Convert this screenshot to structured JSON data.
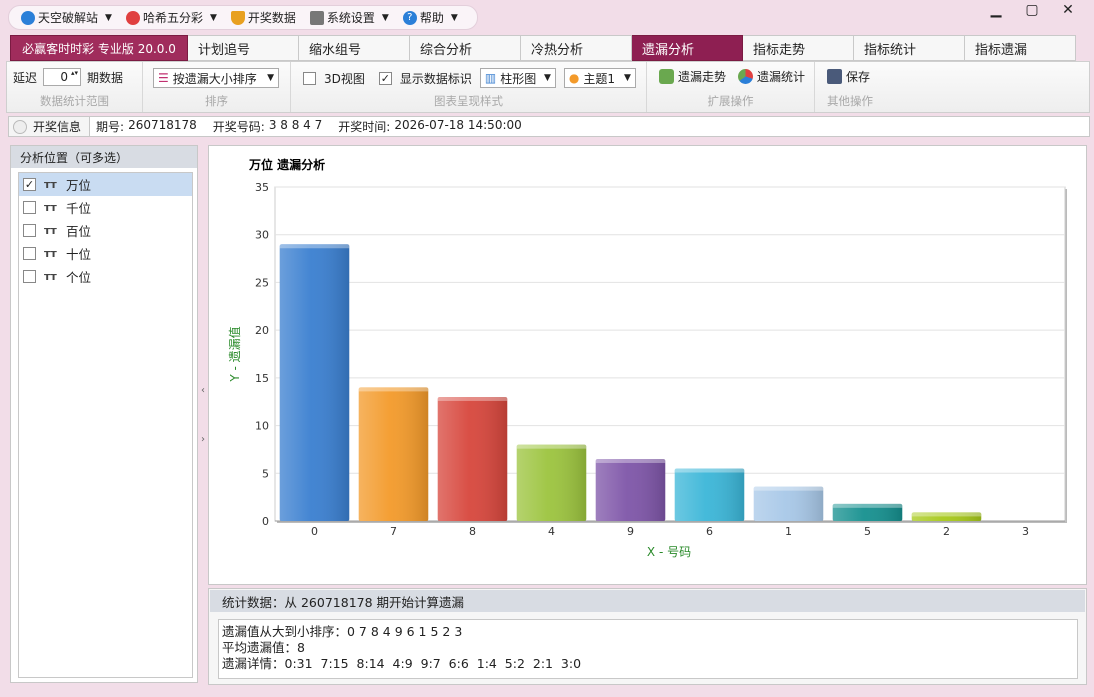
{
  "menu": {
    "items": [
      {
        "label": "天空破解站",
        "icon": "user-icon",
        "color": "#2b7fd8",
        "has_caret": true
      },
      {
        "label": "哈希五分彩",
        "icon": "lottery-icon",
        "color": "#e04040",
        "has_caret": true
      },
      {
        "label": "开奖数据",
        "icon": "trophy-icon",
        "color": "#e8a020",
        "has_caret": false
      },
      {
        "label": "系统设置",
        "icon": "settings-sliders-icon",
        "color": "#666666",
        "has_caret": true
      },
      {
        "label": "帮助",
        "icon": "help-icon",
        "color": "#2b7fd8",
        "has_caret": true
      }
    ]
  },
  "window": {
    "minimize": "▁",
    "maximize": "▢",
    "close": "✕"
  },
  "tabs": {
    "brand": "必赢客时时彩 专业版 20.0.0",
    "items": [
      "计划追号",
      "缩水组号",
      "综合分析",
      "冷热分析",
      "遗漏分析",
      "指标走势",
      "指标统计",
      "指标遗漏"
    ],
    "active": "遗漏分析",
    "active_color": "#8e1f52"
  },
  "toolbar": {
    "delay_label": "延迟",
    "delay_value": "0",
    "period_label": "期数据",
    "group1_label": "数据统计范围",
    "sort_value": "按遗漏大小排序",
    "group2_label": "排序",
    "view3d_label": "3D视图",
    "view3d_checked": false,
    "show_labels_label": "显示数据标识",
    "show_labels_checked": true,
    "chart_type_value": "柱形图",
    "theme_value": "主题1",
    "group3_label": "图表呈现样式",
    "trend_label": "遗漏走势",
    "stats_label": "遗漏统计",
    "group4_label": "扩展操作",
    "save_label": "保存",
    "group5_label": "其他操作"
  },
  "info": {
    "label": "开奖信息",
    "period_key": "期号:",
    "period_value": "260718178",
    "number_key": "开奖号码:",
    "number_value": "3 8 8 4 7",
    "time_key": "开奖时间:",
    "time_value": "2026-07-18 14:50:00"
  },
  "left_panel": {
    "title": "分析位置（可多选）",
    "positions": [
      {
        "label": "万位",
        "checked": true
      },
      {
        "label": "千位",
        "checked": false
      },
      {
        "label": "百位",
        "checked": false
      },
      {
        "label": "十位",
        "checked": false
      },
      {
        "label": "个位",
        "checked": false
      }
    ]
  },
  "chart_data": {
    "type": "bar",
    "title": "万位 遗漏分析",
    "xlabel": "X - 号码",
    "ylabel": "Y - 遗漏值",
    "categories": [
      "0",
      "7",
      "8",
      "4",
      "9",
      "6",
      "1",
      "5",
      "2",
      "3"
    ],
    "values": [
      29,
      14,
      13,
      8,
      6.5,
      5.5,
      3.6,
      1.8,
      0.9,
      0
    ],
    "colors": [
      "#3a7fd0",
      "#f39a2a",
      "#d7463c",
      "#9cc43e",
      "#7e55a8",
      "#3bb6d8",
      "#a8c8e8",
      "#15908f",
      "#a7c91a",
      "#cccccc"
    ],
    "ylim": [
      0,
      35
    ],
    "yticks": [
      0,
      5,
      10,
      15,
      20,
      25,
      30,
      35
    ],
    "grid": true,
    "legend": "none"
  },
  "stats": {
    "header": "统计数据：从 260718178 期开始计算遗漏",
    "line1": "遗漏值从大到小排序：0 7 8 4 9 6 1 5 2 3",
    "line2": "平均遗漏值：8",
    "line3": "遗漏详情：0:31  7:15  8:14  4:9  9:7  6:6  1:4  5:2  2:1  3:0"
  }
}
